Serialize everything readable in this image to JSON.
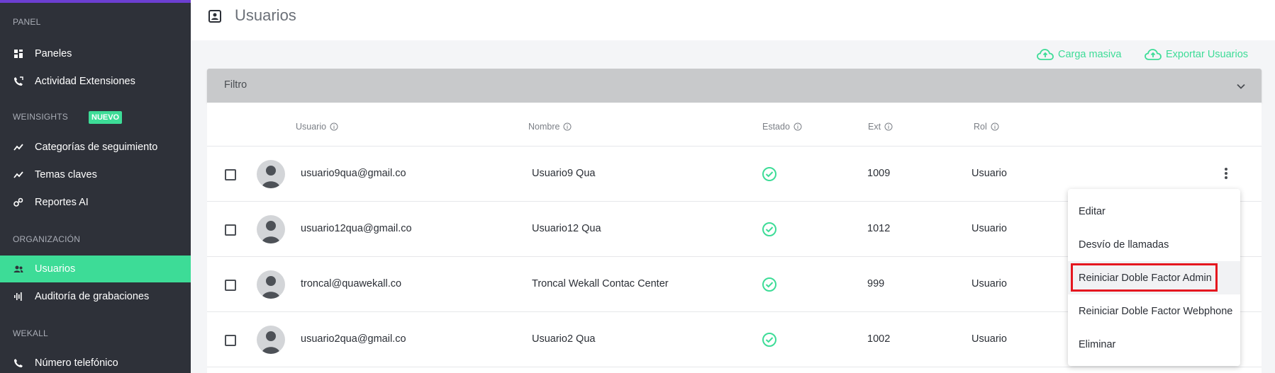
{
  "sidebar": {
    "sections": [
      {
        "label": "PANEL"
      },
      {
        "label": "WEINSIGHTS",
        "badge": "NUEVO"
      },
      {
        "label": "ORGANIZACIÓN"
      },
      {
        "label": "WEKALL"
      }
    ],
    "items": [
      {
        "label": "Paneles",
        "icon": "dashboard-icon"
      },
      {
        "label": "Actividad Extensiones",
        "icon": "phone-activity-icon"
      },
      {
        "label": "Categorías de seguimiento",
        "icon": "trend-icon"
      },
      {
        "label": "Temas claves",
        "icon": "trend-icon"
      },
      {
        "label": "Reportes AI",
        "icon": "ai-icon"
      },
      {
        "label": "Usuarios",
        "icon": "users-icon",
        "active": true
      },
      {
        "label": "Auditoría de grabaciones",
        "icon": "audio-wave-icon"
      },
      {
        "label": "Número telefónico",
        "icon": "phone-icon"
      }
    ],
    "accent_color": "#3ddc97"
  },
  "header": {
    "title": "Usuarios",
    "icon": "contact-card-icon"
  },
  "actions": {
    "bulk_upload": "Carga masiva",
    "export_users": "Exportar Usuarios"
  },
  "filter": {
    "label": "Filtro"
  },
  "table": {
    "columns": [
      "Usuario",
      "Nombre",
      "Estado",
      "Ext",
      "Rol"
    ],
    "rows": [
      {
        "usuario": "usuario9qua@gmail.co",
        "nombre": "Usuario9 Qua",
        "estado": "active",
        "ext": "1009",
        "rol": "Usuario"
      },
      {
        "usuario": "usuario12qua@gmail.co",
        "nombre": "Usuario12 Qua",
        "estado": "active",
        "ext": "1012",
        "rol": "Usuario"
      },
      {
        "usuario": "troncal@quawekall.co",
        "nombre": "Troncal Wekall Contac Center",
        "estado": "active",
        "ext": "999",
        "rol": "Usuario"
      },
      {
        "usuario": "usuario2qua@gmail.co",
        "nombre": "Usuario2 Qua",
        "estado": "active",
        "ext": "1002",
        "rol": "Usuario"
      }
    ]
  },
  "row_menu": {
    "items": [
      {
        "label": "Editar"
      },
      {
        "label": "Desvío de llamadas"
      },
      {
        "label": "Reiniciar Doble Factor Admin",
        "highlighted": true
      },
      {
        "label": "Reiniciar Doble Factor Webphone"
      },
      {
        "label": "Eliminar"
      }
    ]
  }
}
